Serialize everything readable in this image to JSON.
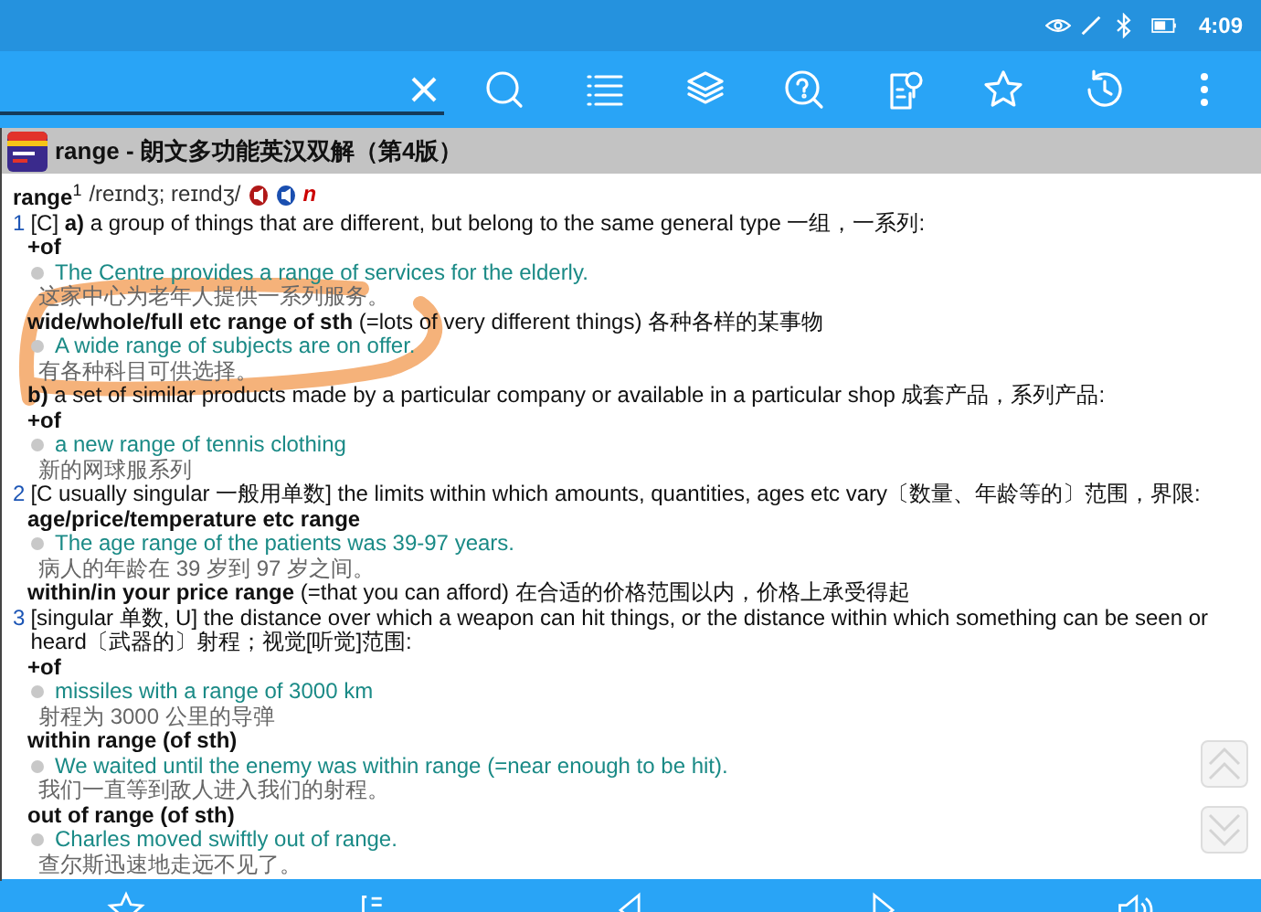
{
  "status_bar": {
    "time": "4:09"
  },
  "title_bar": {
    "title": "range - 朗文多功能英汉双解（第4版）"
  },
  "entry": {
    "headword": "range",
    "homograph": "1",
    "pronunciation": "/reɪndʒ; reɪndʒ/",
    "part_of_speech": "n",
    "lines": [
      {
        "kind": "sense",
        "number": "1",
        "text": "[C] **a)** a group of things that are different, but belong to the same general type 一组，一系列:"
      },
      {
        "kind": "grammar",
        "text": "+of"
      },
      {
        "kind": "example",
        "text": "The Centre provides a range of services for the elderly."
      },
      {
        "kind": "translation",
        "text": "这家中心为老年人提供一系列服务。"
      },
      {
        "kind": "phrase",
        "text": "**wide/whole/full etc range of sth** (=lots of very different things) 各种各样的某事物"
      },
      {
        "kind": "example",
        "text": "A wide range of subjects are on offer."
      },
      {
        "kind": "translation",
        "text": "有各种科目可供选择。"
      },
      {
        "kind": "subsense",
        "text": "**b)** a set of similar products made by a particular company or available in a particular shop 成套产品，系列产品:"
      },
      {
        "kind": "grammar",
        "text": "+of"
      },
      {
        "kind": "example",
        "text": "a new range of tennis clothing"
      },
      {
        "kind": "translation",
        "text": "新的网球服系列"
      },
      {
        "kind": "sense",
        "number": "2",
        "text": "[C usually singular 一般用单数] the limits within which amounts, quantities, ages etc vary〔数量、年龄等的〕范围，界限:"
      },
      {
        "kind": "grammar",
        "text": "age/price/temperature etc range"
      },
      {
        "kind": "example",
        "text": "The age range of the patients was 39-97 years."
      },
      {
        "kind": "translation",
        "text": "病人的年龄在 39 岁到 97 岁之间。"
      },
      {
        "kind": "phrase",
        "text": "**within/in your price range** (=that you can afford) 在合适的价格范围以内，价格上承受得起"
      },
      {
        "kind": "sense",
        "number": "3",
        "text": "[singular 单数, U] the distance over which a weapon can hit things, or the distance within which something can be seen or heard〔武器的〕射程；视觉[听觉]范围:"
      },
      {
        "kind": "grammar",
        "text": "+of"
      },
      {
        "kind": "example",
        "text": "missiles with a range of 3000 km"
      },
      {
        "kind": "translation",
        "text": "射程为 3000 公里的导弹"
      },
      {
        "kind": "grammar",
        "text": "within range (of sth)"
      },
      {
        "kind": "example",
        "text": "We waited until the enemy was within range (=near enough to be hit)."
      },
      {
        "kind": "translation",
        "text": "我们一直等到敌人进入我们的射程。"
      },
      {
        "kind": "grammar",
        "text": "out of range (of sth)"
      },
      {
        "kind": "example",
        "text": "Charles moved swiftly out of range."
      },
      {
        "kind": "translation",
        "text": "查尔斯迅速地走远不见了。"
      }
    ]
  }
}
